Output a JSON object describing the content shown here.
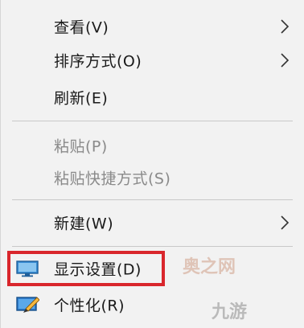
{
  "menu": {
    "items": [
      {
        "label": "查看(V)",
        "has_submenu": true,
        "enabled": true
      },
      {
        "label": "排序方式(O)",
        "has_submenu": true,
        "enabled": true
      },
      {
        "label": "刷新(E)",
        "has_submenu": false,
        "enabled": true
      },
      {
        "label": "粘贴(P)",
        "has_submenu": false,
        "enabled": false
      },
      {
        "label": "粘贴快捷方式(S)",
        "has_submenu": false,
        "enabled": false
      },
      {
        "label": "新建(W)",
        "has_submenu": true,
        "enabled": true
      },
      {
        "label": "显示设置(D)",
        "has_submenu": false,
        "enabled": true,
        "icon": "display-icon",
        "highlighted": true
      },
      {
        "label": "个性化(R)",
        "has_submenu": false,
        "enabled": true,
        "icon": "personalize-icon"
      }
    ]
  },
  "watermark": {
    "text1": "奥之网",
    "text2": "九游"
  },
  "colors": {
    "highlight_border": "#d9262c",
    "menu_background": "#f2f2f2",
    "disabled_text": "#8a8a8a"
  }
}
